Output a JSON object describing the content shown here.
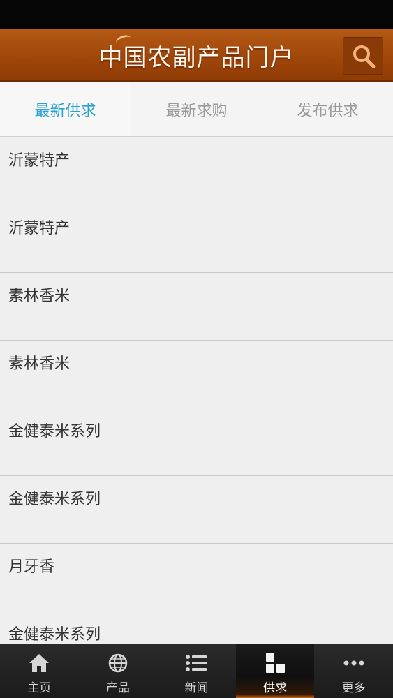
{
  "app": {
    "title": "中国农副产品门户"
  },
  "tabs": [
    {
      "label": "最新供求",
      "active": true
    },
    {
      "label": "最新求购",
      "active": false
    },
    {
      "label": "发布供求",
      "active": false
    }
  ],
  "list": [
    "沂蒙特产",
    "沂蒙特产",
    "素林香米",
    "素林香米",
    "金健泰米系列",
    "金健泰米系列",
    "月牙香",
    "金健泰米系列"
  ],
  "bottom_nav": [
    {
      "label": "主页",
      "icon": "home-icon"
    },
    {
      "label": "产品",
      "icon": "globe-icon"
    },
    {
      "label": "新闻",
      "icon": "list-icon"
    },
    {
      "label": "供求",
      "icon": "blocks-icon",
      "active": true
    },
    {
      "label": "更多",
      "icon": "more-icon"
    }
  ],
  "colors": {
    "header": "#a44a0c",
    "active_tab": "#2aa1d3",
    "nav_active_accent": "#e8761a"
  }
}
